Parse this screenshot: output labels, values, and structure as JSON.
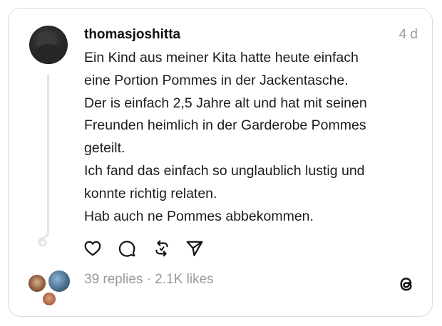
{
  "post": {
    "username": "thomasjoshitta",
    "time": "4 d",
    "text_lines": [
      "Ein Kind aus meiner Kita hatte heute einfach",
      "eine Portion Pommes in der Jackentasche.",
      "Der is einfach 2,5 Jahre alt und hat mit seinen",
      "Freunden heimlich in der Garderobe Pommes",
      "geteilt.",
      "Ich fand das einfach so unglaublich lustig und",
      "konnte richtig relaten.",
      "Hab auch ne Pommes abbekommen."
    ],
    "stats": {
      "replies": "39 replies",
      "separator": "·",
      "likes": "2.1K likes"
    }
  },
  "actions": {
    "icons": [
      "heart-icon",
      "comment-icon",
      "repost-icon",
      "share-icon"
    ]
  },
  "brand": {
    "logo_icon": "threads-logo-icon"
  },
  "colors": {
    "text": "#1c1c1c",
    "muted": "#9a9a9a",
    "border": "#dcdcdc"
  }
}
